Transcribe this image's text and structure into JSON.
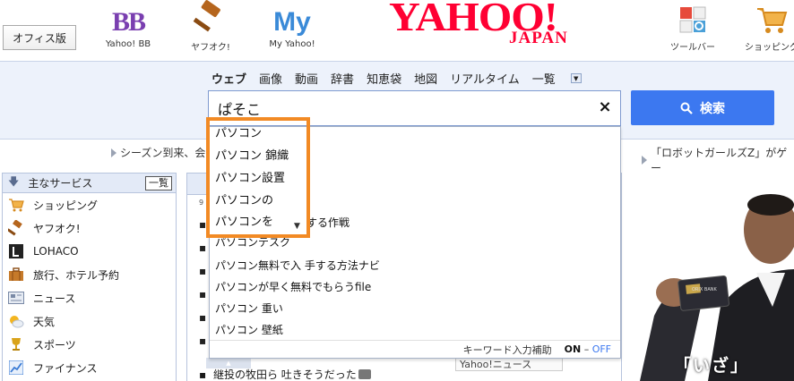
{
  "header": {
    "office_button": "オフィス版",
    "links": [
      {
        "label": "Yahoo! BB",
        "icon": "yahoo-bb-logo"
      },
      {
        "label": "ヤフオク!",
        "icon": "auction-gavel-icon"
      },
      {
        "label": "My Yahoo!",
        "icon": "my-yahoo-logo"
      },
      {
        "label": "ツールバー",
        "icon": "toolbar-icon"
      },
      {
        "label": "ショッピング",
        "icon": "shopping-cart-icon"
      }
    ],
    "logo_text": "YAHOO!",
    "logo_sub": "JAPAN",
    "bb_mark": "BB",
    "my_mark": "My"
  },
  "search": {
    "tabs": [
      "ウェブ",
      "画像",
      "動画",
      "辞書",
      "知恵袋",
      "地図",
      "リアルタイム"
    ],
    "more_label": "一覧",
    "query": "ぱそこ",
    "clear": "×",
    "button_label": "検索",
    "suggestions": [
      "パソコン",
      "パソコン 錦織",
      "パソコン設置",
      "パソコンの",
      "パソコンを",
      "パソコンテスク",
      "パソコン無料で入 手する方法ナビ",
      "パソコンが早く無料でもらうfile",
      "パソコン 重い",
      "パソコン 壁紙"
    ],
    "overlay_text": "する作戦",
    "footer_label": "キーワード入力補助",
    "footer_on": "ON",
    "footer_dash": "–",
    "footer_off": "OFF"
  },
  "ticker": {
    "left": "シーズン到来、会",
    "right": "「ロボットガールズZ」がゲー"
  },
  "nav": {
    "title": "主なサービス",
    "all": "一覧",
    "items": [
      {
        "label": "ショッピング",
        "icon": "shopping-cart-icon",
        "color": "#e8a23a"
      },
      {
        "label": "ヤフオク!",
        "icon": "auction-gavel-icon",
        "color": "#b5651d"
      },
      {
        "label": "LOHACO",
        "icon": "lohaco-icon",
        "color": "#222222"
      },
      {
        "label": "旅行、ホテル予約",
        "icon": "suitcase-icon",
        "color": "#c67a2a"
      },
      {
        "label": "ニュース",
        "icon": "newspaper-icon",
        "color": "#7a8aa6"
      },
      {
        "label": "天気",
        "icon": "weather-icon",
        "color": "#f3b520"
      },
      {
        "label": "スポーツ",
        "icon": "trophy-icon",
        "color": "#d9a31a"
      },
      {
        "label": "ファイナンス",
        "icon": "chart-icon",
        "color": "#3a7bd5"
      }
    ]
  },
  "news": {
    "small_text": "9",
    "bottom_line": "継投の牧田ら 吐きそうだった",
    "yahoo_news": "Yahoo!ニュース"
  },
  "ad": {
    "caption": "「いざ」",
    "card_text": "ORIX BANK"
  }
}
